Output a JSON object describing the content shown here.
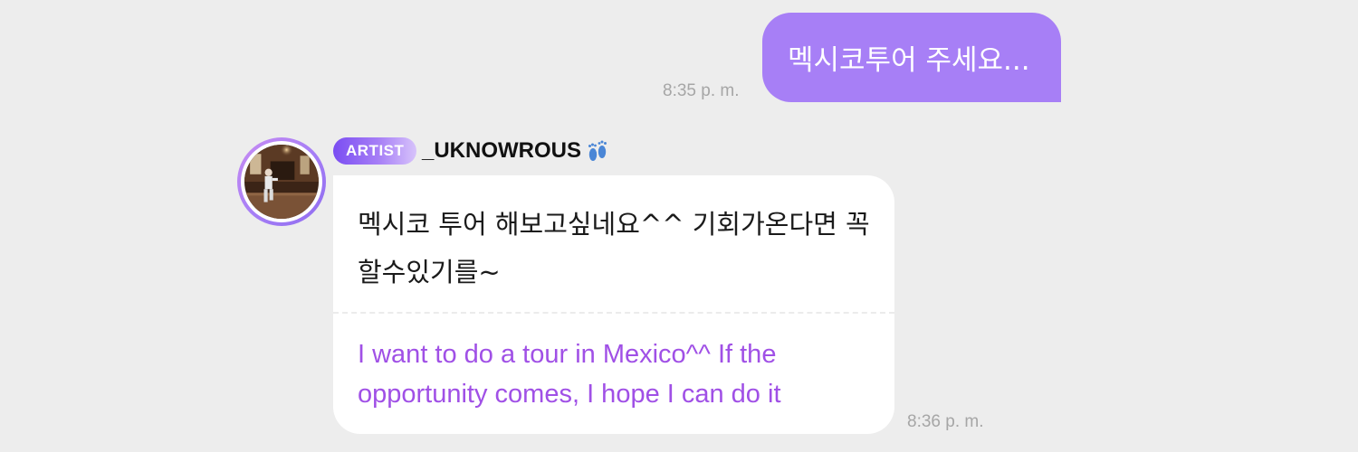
{
  "outgoing_message": {
    "text": "멕시코투어 주세요...",
    "time": "8:35 p. m."
  },
  "incoming_message": {
    "badge": "ARTIST",
    "sender_name": "_UKNOWROUS",
    "sender_emoji_icon": "footprints-icon",
    "original_text": "멕시코 투어 해보고싶네요^^ 기회가온다면 꼭할수있기를~",
    "translation": "I want to do a tour in Mexico^^ If the opportunity comes, I hope I can do it",
    "time": "8:36 p. m."
  },
  "colors": {
    "background": "#ededed",
    "outgoing_bubble": "#a77ff6",
    "incoming_bubble": "#ffffff",
    "translation_text": "#a050e6",
    "timestamp": "#a6a6a6",
    "badge_gradient_start": "#7a4df2",
    "badge_gradient_end": "#d7c3fb"
  }
}
